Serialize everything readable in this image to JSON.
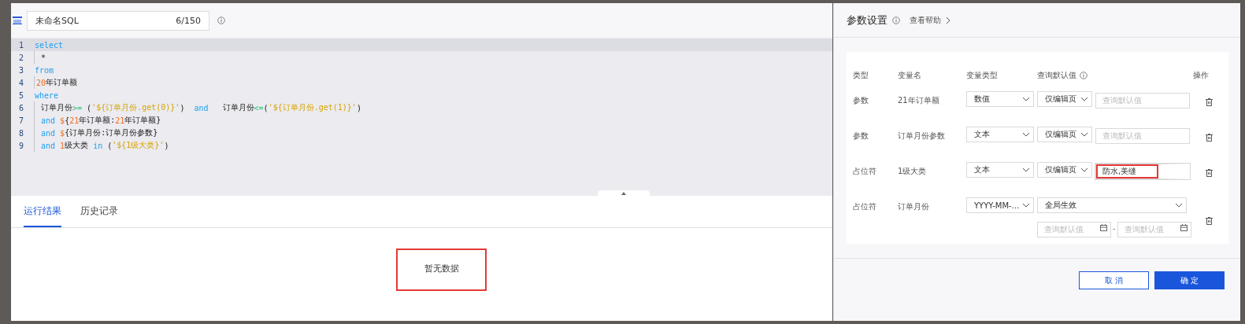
{
  "query": {
    "name": "未命名SQL",
    "counter": "6/150"
  },
  "code_lines": [
    {
      "number": "1",
      "active": true,
      "indented": false,
      "tokens": [
        {
          "kind": "keyword",
          "text": "select"
        }
      ]
    },
    {
      "number": "2",
      "active": false,
      "indented": true,
      "tokens": [
        {
          "kind": "plain",
          "text": " *"
        }
      ]
    },
    {
      "number": "3",
      "active": false,
      "indented": false,
      "tokens": [
        {
          "kind": "keyword",
          "text": "from"
        }
      ]
    },
    {
      "number": "4",
      "active": false,
      "indented": true,
      "tokens": [
        {
          "kind": "number",
          "text": "20"
        },
        {
          "kind": "plain",
          "text": "年订单额"
        }
      ]
    },
    {
      "number": "5",
      "active": false,
      "indented": false,
      "tokens": [
        {
          "kind": "keyword",
          "text": "where"
        }
      ]
    },
    {
      "number": "6",
      "active": false,
      "indented": true,
      "tokens": [
        {
          "kind": "plain",
          "text": " 订单月份"
        },
        {
          "kind": "operator",
          "text": ">="
        },
        {
          "kind": "plain",
          "text": " ("
        },
        {
          "kind": "string",
          "text": "'${订单月份.get(0)}'"
        },
        {
          "kind": "plain",
          "text": ")  "
        },
        {
          "kind": "keyword",
          "text": "and"
        },
        {
          "kind": "plain",
          "text": "   订单月份"
        },
        {
          "kind": "operator",
          "text": "<="
        },
        {
          "kind": "plain",
          "text": "("
        },
        {
          "kind": "string",
          "text": "'${订单月份.get(1)}'"
        },
        {
          "kind": "plain",
          "text": ")"
        }
      ]
    },
    {
      "number": "7",
      "active": false,
      "indented": true,
      "tokens": [
        {
          "kind": "keyword",
          "text": " and "
        },
        {
          "kind": "number",
          "text": "$"
        },
        {
          "kind": "plain",
          "text": "{"
        },
        {
          "kind": "number",
          "text": "21"
        },
        {
          "kind": "plain",
          "text": "年订单额:"
        },
        {
          "kind": "number",
          "text": "21"
        },
        {
          "kind": "plain",
          "text": "年订单额}"
        }
      ]
    },
    {
      "number": "8",
      "active": false,
      "indented": true,
      "tokens": [
        {
          "kind": "keyword",
          "text": " and "
        },
        {
          "kind": "number",
          "text": "$"
        },
        {
          "kind": "plain",
          "text": "{订单月份:订单月份参数}"
        }
      ]
    },
    {
      "number": "9",
      "active": false,
      "indented": true,
      "tokens": [
        {
          "kind": "keyword",
          "text": " and "
        },
        {
          "kind": "number",
          "text": "1"
        },
        {
          "kind": "plain",
          "text": "级大类 "
        },
        {
          "kind": "keyword",
          "text": "in"
        },
        {
          "kind": "plain",
          "text": " ("
        },
        {
          "kind": "string",
          "text": "'${1级大类}'"
        },
        {
          "kind": "plain",
          "text": ")"
        }
      ]
    }
  ],
  "result_tabs": [
    {
      "label": "运行结果",
      "selected": true
    },
    {
      "label": "历史记录",
      "selected": false
    }
  ],
  "empty_state": {
    "text": "暂无数据",
    "highlighted": true
  },
  "params_panel": {
    "title": "参数设置",
    "help_link": "查看帮助",
    "columns": [
      "类型",
      "变量名",
      "变量类型",
      "查询默认值",
      "操作"
    ],
    "rows": [
      {
        "kind": "single",
        "type": "参数",
        "name": "21年订单额",
        "var_type": "数值",
        "scope": "仅编辑页",
        "default": {
          "placeholder": "查询默认值",
          "highlighted": false
        }
      },
      {
        "kind": "single",
        "type": "参数",
        "name": "订单月份参数",
        "var_type": "文本",
        "scope": "仅编辑页",
        "default": {
          "placeholder": "查询默认值",
          "highlighted": false
        }
      },
      {
        "kind": "single",
        "type": "占位符",
        "name": "1级大类",
        "var_type": "文本",
        "scope": "仅编辑页",
        "default": {
          "value": "防水,美缝",
          "highlighted": true
        }
      },
      {
        "kind": "range",
        "type": "占位符",
        "name": "订单月份",
        "var_type": "YYYY-MM-...",
        "scope": "全局生效",
        "range_separator": "-",
        "range": [
          {
            "placeholder": "查询默认值"
          },
          {
            "placeholder": "查询默认值"
          }
        ]
      }
    ],
    "buttons": [
      {
        "label": "取 消",
        "kind": "secondary"
      },
      {
        "label": "确 定",
        "kind": "primary"
      }
    ]
  }
}
